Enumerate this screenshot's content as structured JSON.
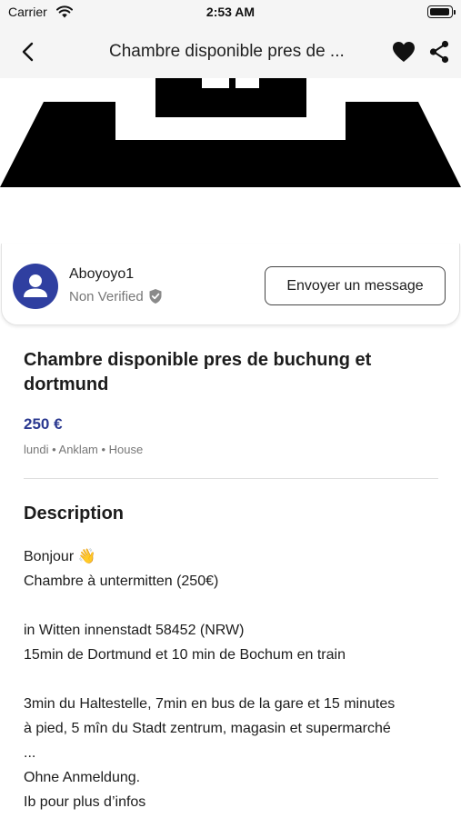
{
  "status_bar": {
    "carrier": "Carrier",
    "time": "2:53 AM",
    "wifi_icon": "wifi-icon",
    "battery_icon": "battery-icon"
  },
  "nav": {
    "title": "Chambre disponible pres de ...",
    "back_icon": "chevron-left-icon",
    "favorite_icon": "heart-icon",
    "share_icon": "share-icon"
  },
  "owner": {
    "name": "Aboyoyo1",
    "verification": "Non Verified",
    "verification_icon": "shield-check-icon",
    "avatar_icon": "person-icon",
    "message_button": "Envoyer un message"
  },
  "listing": {
    "title": "Chambre disponible pres de buchung et dortmund",
    "price": "250 €",
    "meta": "lundi • Anklam • House"
  },
  "description": {
    "heading": "Description",
    "lines": [
      "Bonjour 👋",
      "Chambre à untermitten (250€)",
      "",
      "in Witten innenstadt 58452 (NRW)",
      "15min de Dortmund et 10 min de Bochum en train",
      "",
      "3min du Haltestelle, 7min en bus de la gare et 15 minutes",
      "à pied, 5 mîn du Stadt zentrum, magasin et supermarché",
      "...",
      "Ohne Anmeldung.",
      "Ib pour plus d’infos"
    ]
  },
  "colors": {
    "accent": "#2b3990",
    "avatar_bg": "#2f3fa0",
    "nav_bg": "#f5f5f5"
  }
}
